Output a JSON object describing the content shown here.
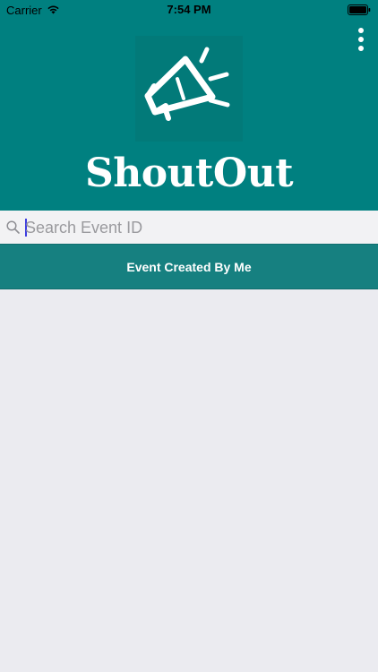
{
  "status_bar": {
    "carrier": "Carrier",
    "time": "7:54 PM",
    "wifi_icon": "wifi-icon",
    "battery_icon": "battery-icon"
  },
  "header": {
    "app_name": "ShoutOut",
    "logo_icon": "megaphone-icon",
    "menu_icon": "more-vertical-icon",
    "background": "#008080"
  },
  "search": {
    "placeholder": "Search Event ID",
    "value": "",
    "icon": "search-icon"
  },
  "event_button": {
    "label": "Event Created By Me",
    "background": "#168080"
  },
  "colors": {
    "accent": "#008080",
    "page_background": "#ebebf0",
    "search_background": "#f2f2f4"
  }
}
